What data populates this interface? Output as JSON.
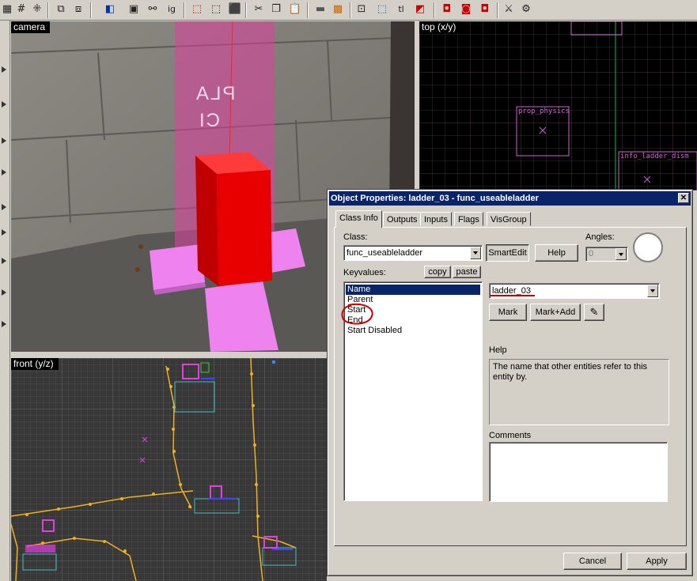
{
  "viewports": {
    "camera": "camera",
    "top": "top (x/y)",
    "front": "front (y/z)"
  },
  "scene": {
    "top_labels": [
      "prop_physics",
      "info_ladder_dism"
    ],
    "wall_text_line1": "PLA",
    "wall_text_line2": "CI"
  },
  "dialog": {
    "title": "Object Properties: ladder_03 - func_useableladder",
    "close_glyph": "✕",
    "tabs": [
      {
        "label": "Class Info",
        "active": true
      },
      {
        "label": "Outputs",
        "active": false
      },
      {
        "label": "Inputs",
        "active": false
      },
      {
        "label": "Flags",
        "active": false
      },
      {
        "label": "VisGroup",
        "active": false
      }
    ],
    "class_label": "Class:",
    "class_value": "func_useableladder",
    "smartedit_label": "SmartEdit",
    "help_button_label": "Help",
    "angles_label": "Angles:",
    "angles_value": "0",
    "keyvalues_label": "Keyvalues:",
    "copy_label": "copy",
    "paste_label": "paste",
    "keyvalues": [
      "Name",
      "Parent",
      "Start",
      "End",
      "Start Disabled"
    ],
    "selected_keyvalue": "Name",
    "value_field": "ladder_03",
    "mark_label": "Mark",
    "mark_add_label": "Mark+Add",
    "eyedropper_icon": "eyedropper-icon",
    "help_heading": "Help",
    "help_text": "The name that other entities refer to this entity by.",
    "comments_label": "Comments",
    "comments_value": "",
    "cancel_label": "Cancel",
    "apply_label": "Apply"
  },
  "colors": {
    "titlebar": "#0a246a",
    "selection": "#0a246a",
    "entity_red": "#e00000",
    "ladder_pink": "#ee82ee",
    "annotation_red": "#cc0000"
  }
}
